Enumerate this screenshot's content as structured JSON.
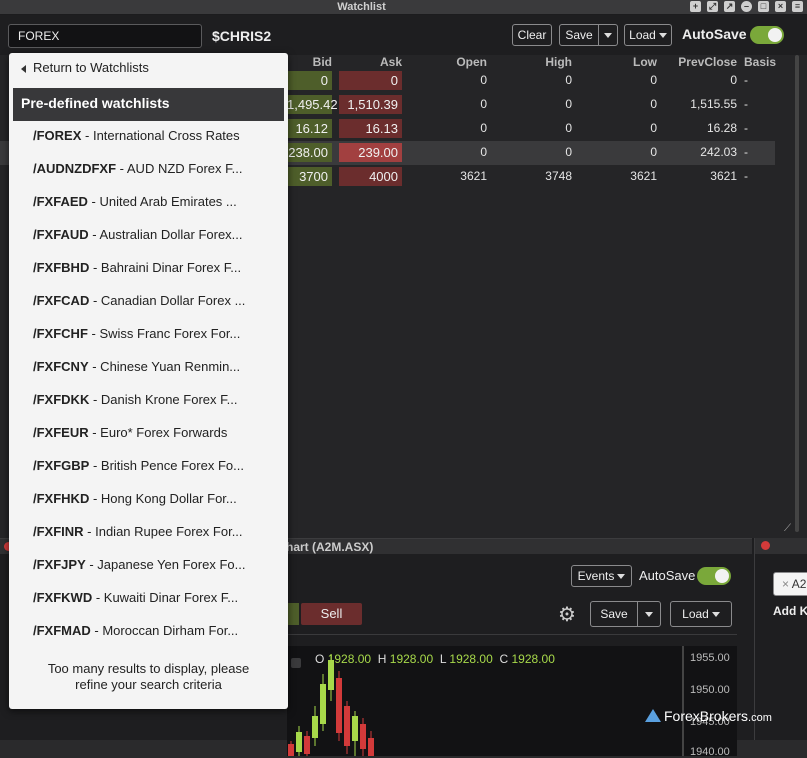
{
  "window": {
    "title": "Watchlist"
  },
  "toolbar": {
    "search_value": "FOREX",
    "symbol": "$CHRIS2",
    "clear_label": "Clear",
    "save_label": "Save",
    "load_label": "Load",
    "autosave_label": "AutoSave",
    "autosave_on": true
  },
  "grid": {
    "columns": [
      "Bid",
      "Ask",
      "Open",
      "High",
      "Low",
      "PrevClose",
      "Basis"
    ],
    "rows": [
      {
        "bid": "0",
        "ask": "0",
        "open": "0",
        "high": "0",
        "low": "0",
        "prevclose": "0",
        "basis": "-"
      },
      {
        "bid": "1,495.42",
        "ask": "1,510.39",
        "open": "0",
        "high": "0",
        "low": "0",
        "prevclose": "1,515.55",
        "basis": "-"
      },
      {
        "bid": "16.12",
        "ask": "16.13",
        "open": "0",
        "high": "0",
        "low": "0",
        "prevclose": "16.28",
        "basis": "-"
      },
      {
        "bid": "238.00",
        "ask": "239.00",
        "open": "0",
        "high": "0",
        "low": "0",
        "prevclose": "242.03",
        "basis": "-"
      },
      {
        "bid": "3700",
        "ask": "4000",
        "open": "3621",
        "high": "3748",
        "low": "3621",
        "prevclose": "3621",
        "basis": "-"
      }
    ]
  },
  "dropdown": {
    "back_label": "Return to Watchlists",
    "section_title": "Pre-defined watchlists",
    "items": [
      {
        "code": "/FOREX",
        "desc": " - International Cross Rates"
      },
      {
        "code": "/AUDNZDFXF",
        "desc": " - AUD NZD Forex F..."
      },
      {
        "code": "/FXFAED",
        "desc": " - United Arab Emirates ..."
      },
      {
        "code": "/FXFAUD",
        "desc": " - Australian Dollar Forex..."
      },
      {
        "code": "/FXFBHD",
        "desc": " - Bahraini Dinar Forex F..."
      },
      {
        "code": "/FXFCAD",
        "desc": " - Canadian Dollar Forex ..."
      },
      {
        "code": "/FXFCHF",
        "desc": " - Swiss Franc Forex For..."
      },
      {
        "code": "/FXFCNY",
        "desc": " - Chinese Yuan Renmin..."
      },
      {
        "code": "/FXFDKK",
        "desc": " - Danish Krone Forex F..."
      },
      {
        "code": "/FXFEUR",
        "desc": " - Euro* Forex Forwards"
      },
      {
        "code": "/FXFGBP",
        "desc": " - British Pence Forex Fo..."
      },
      {
        "code": "/FXFHKD",
        "desc": " - Hong Kong Dollar For..."
      },
      {
        "code": "/FXFINR",
        "desc": " - Indian Rupee Forex For..."
      },
      {
        "code": "/FXFJPY",
        "desc": " - Japanese Yen Forex Fo..."
      },
      {
        "code": "/FXFKWD",
        "desc": " - Kuwaiti Dinar Forex F..."
      },
      {
        "code": "/FXFMAD",
        "desc": " - Moroccan Dirham For..."
      }
    ],
    "footer_line1": "Too many results to display, please",
    "footer_line2": "refine your search criteria"
  },
  "chart": {
    "tab_title": "hart (A2M.ASX)",
    "events_label": "Events",
    "autosave_label": "AutoSave",
    "sell_label": "Sell",
    "save_label": "Save",
    "load_label": "Load",
    "ohlc": {
      "o_label": "O",
      "o": "1928.00",
      "h_label": "H",
      "h": "1928.00",
      "l_label": "L",
      "l": "1928.00",
      "c_label": "C",
      "c": "1928.00"
    },
    "y_labels": [
      "1955.00",
      "1950.00",
      "1945.00",
      "1940.00"
    ]
  },
  "right_panel": {
    "tag_text": "A2",
    "add_label": "Add Ke"
  },
  "watermark": {
    "brand": "ForexBrokers",
    "domain": ".com"
  }
}
